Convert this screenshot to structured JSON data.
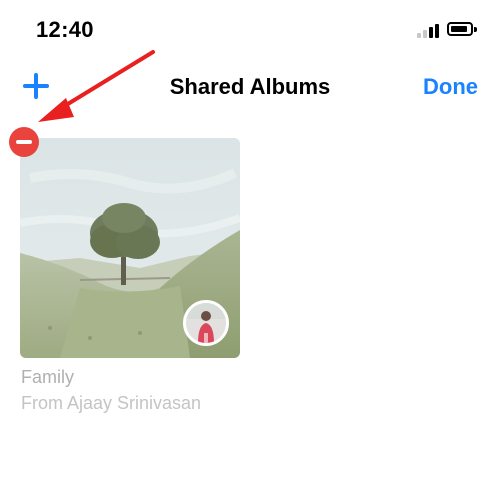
{
  "status_bar": {
    "time": "12:40",
    "signal_icon": "cellular-signal-icon",
    "battery_icon": "battery-icon"
  },
  "nav": {
    "add_icon": "plus-icon",
    "title": "Shared Albums",
    "done_label": "Done"
  },
  "album": {
    "name": "Family",
    "owner": "From Ajaay Srinivasan",
    "delete_icon": "minus-circle-icon",
    "avatar_icon": "avatar"
  },
  "annotation": {
    "arrow_icon": "red-arrow-icon"
  },
  "colors": {
    "accent": "#1a82ff",
    "delete": "#e8443d",
    "annotation": "#e8201f"
  }
}
